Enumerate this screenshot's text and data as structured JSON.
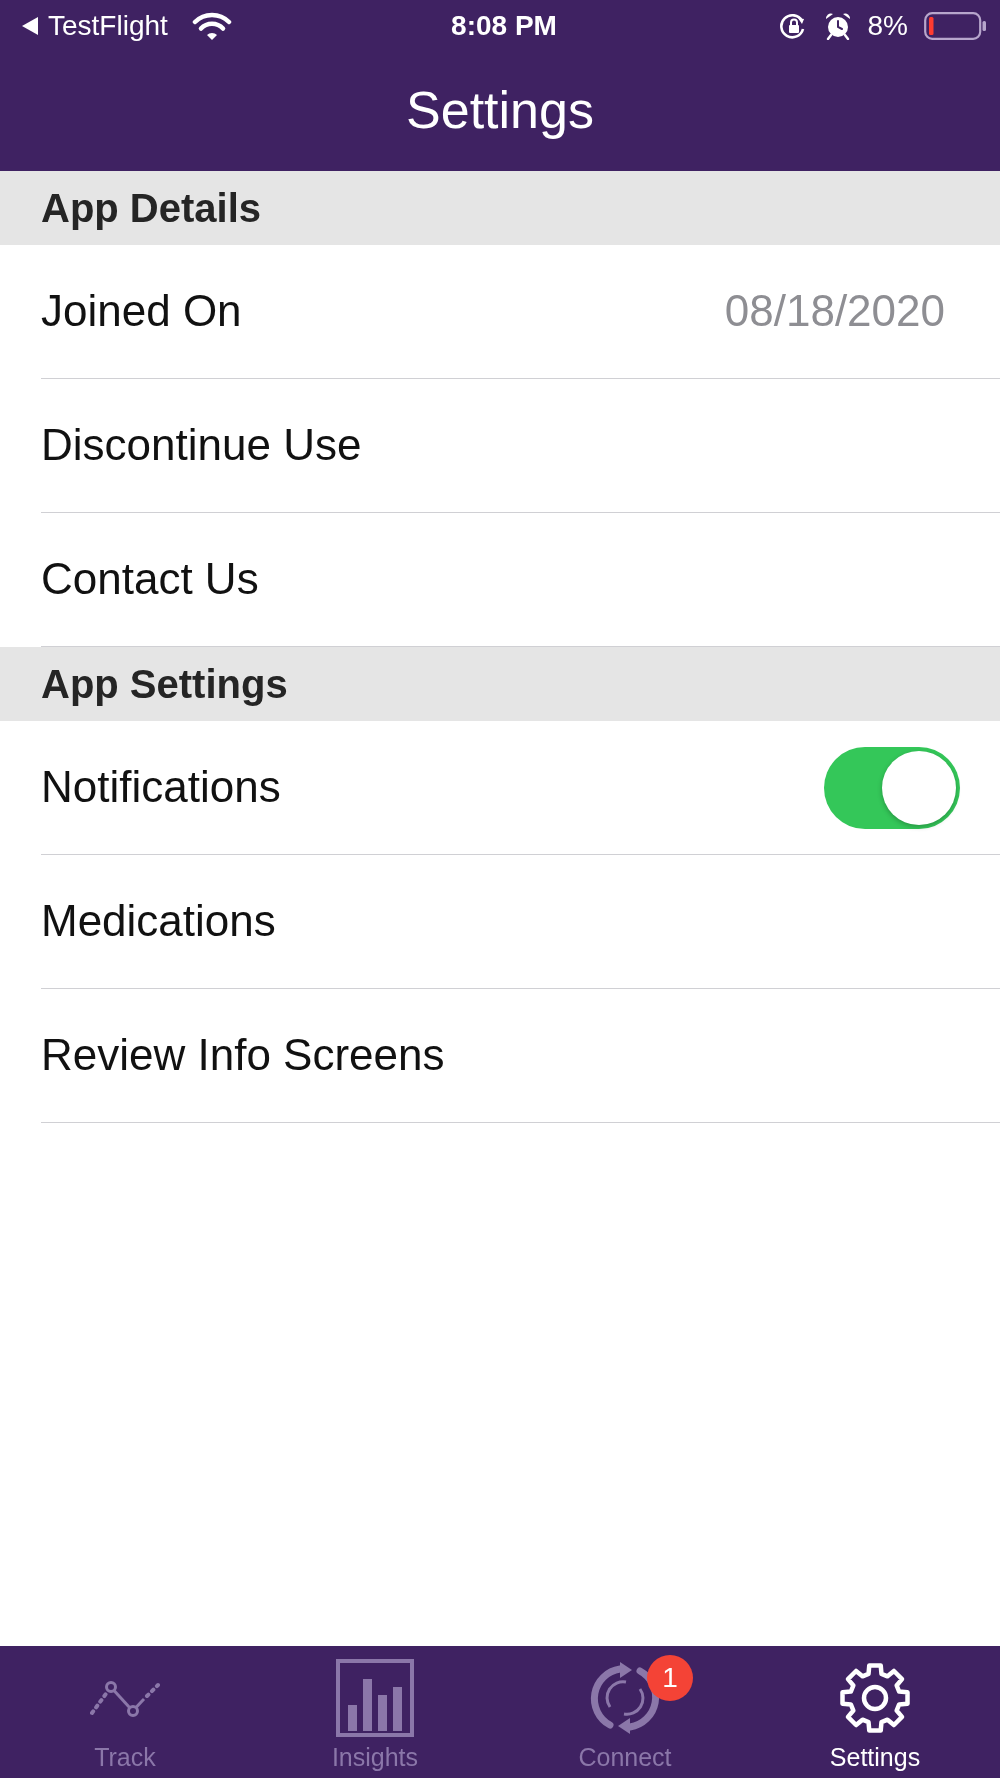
{
  "status_bar": {
    "back_label": "TestFlight",
    "time": "8:08 PM",
    "battery_percent": "8%"
  },
  "header": {
    "title": "Settings"
  },
  "sections": [
    {
      "title": "App Details",
      "rows": [
        {
          "kind": "value",
          "label": "Joined On",
          "value": "08/18/2020"
        },
        {
          "kind": "link",
          "label": "Discontinue Use"
        },
        {
          "kind": "link",
          "label": "Contact Us"
        }
      ]
    },
    {
      "title": "App Settings",
      "rows": [
        {
          "kind": "toggle",
          "label": "Notifications",
          "on": true
        },
        {
          "kind": "link",
          "label": "Medications"
        },
        {
          "kind": "link",
          "label": "Review Info Screens"
        }
      ]
    }
  ],
  "tab_bar": {
    "tabs": [
      {
        "label": "Track",
        "selected": false
      },
      {
        "label": "Insights",
        "selected": false
      },
      {
        "label": "Connect",
        "badge": "1",
        "selected": false
      },
      {
        "label": "Settings",
        "selected": true
      }
    ]
  }
}
